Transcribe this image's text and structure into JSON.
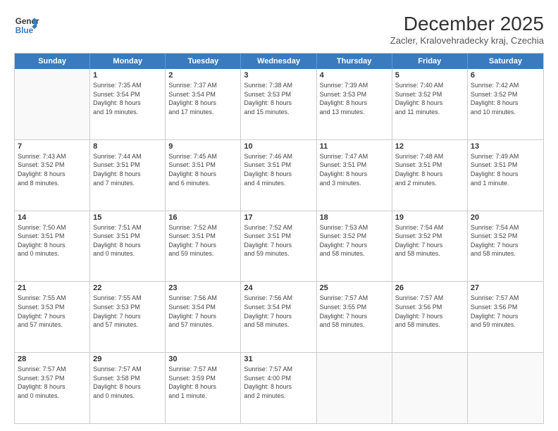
{
  "header": {
    "logo_line1": "General",
    "logo_line2": "Blue",
    "month_title": "December 2025",
    "subtitle": "Zacler, Kralovehradecky kraj, Czechia"
  },
  "weekdays": [
    "Sunday",
    "Monday",
    "Tuesday",
    "Wednesday",
    "Thursday",
    "Friday",
    "Saturday"
  ],
  "rows": [
    [
      {
        "num": "",
        "info": ""
      },
      {
        "num": "1",
        "info": "Sunrise: 7:35 AM\nSunset: 3:54 PM\nDaylight: 8 hours\nand 19 minutes."
      },
      {
        "num": "2",
        "info": "Sunrise: 7:37 AM\nSunset: 3:54 PM\nDaylight: 8 hours\nand 17 minutes."
      },
      {
        "num": "3",
        "info": "Sunrise: 7:38 AM\nSunset: 3:53 PM\nDaylight: 8 hours\nand 15 minutes."
      },
      {
        "num": "4",
        "info": "Sunrise: 7:39 AM\nSunset: 3:53 PM\nDaylight: 8 hours\nand 13 minutes."
      },
      {
        "num": "5",
        "info": "Sunrise: 7:40 AM\nSunset: 3:52 PM\nDaylight: 8 hours\nand 11 minutes."
      },
      {
        "num": "6",
        "info": "Sunrise: 7:42 AM\nSunset: 3:52 PM\nDaylight: 8 hours\nand 10 minutes."
      }
    ],
    [
      {
        "num": "7",
        "info": "Sunrise: 7:43 AM\nSunset: 3:52 PM\nDaylight: 8 hours\nand 8 minutes."
      },
      {
        "num": "8",
        "info": "Sunrise: 7:44 AM\nSunset: 3:51 PM\nDaylight: 8 hours\nand 7 minutes."
      },
      {
        "num": "9",
        "info": "Sunrise: 7:45 AM\nSunset: 3:51 PM\nDaylight: 8 hours\nand 6 minutes."
      },
      {
        "num": "10",
        "info": "Sunrise: 7:46 AM\nSunset: 3:51 PM\nDaylight: 8 hours\nand 4 minutes."
      },
      {
        "num": "11",
        "info": "Sunrise: 7:47 AM\nSunset: 3:51 PM\nDaylight: 8 hours\nand 3 minutes."
      },
      {
        "num": "12",
        "info": "Sunrise: 7:48 AM\nSunset: 3:51 PM\nDaylight: 8 hours\nand 2 minutes."
      },
      {
        "num": "13",
        "info": "Sunrise: 7:49 AM\nSunset: 3:51 PM\nDaylight: 8 hours\nand 1 minute."
      }
    ],
    [
      {
        "num": "14",
        "info": "Sunrise: 7:50 AM\nSunset: 3:51 PM\nDaylight: 8 hours\nand 0 minutes."
      },
      {
        "num": "15",
        "info": "Sunrise: 7:51 AM\nSunset: 3:51 PM\nDaylight: 8 hours\nand 0 minutes."
      },
      {
        "num": "16",
        "info": "Sunrise: 7:52 AM\nSunset: 3:51 PM\nDaylight: 7 hours\nand 59 minutes."
      },
      {
        "num": "17",
        "info": "Sunrise: 7:52 AM\nSunset: 3:51 PM\nDaylight: 7 hours\nand 59 minutes."
      },
      {
        "num": "18",
        "info": "Sunrise: 7:53 AM\nSunset: 3:52 PM\nDaylight: 7 hours\nand 58 minutes."
      },
      {
        "num": "19",
        "info": "Sunrise: 7:54 AM\nSunset: 3:52 PM\nDaylight: 7 hours\nand 58 minutes."
      },
      {
        "num": "20",
        "info": "Sunrise: 7:54 AM\nSunset: 3:52 PM\nDaylight: 7 hours\nand 58 minutes."
      }
    ],
    [
      {
        "num": "21",
        "info": "Sunrise: 7:55 AM\nSunset: 3:53 PM\nDaylight: 7 hours\nand 57 minutes."
      },
      {
        "num": "22",
        "info": "Sunrise: 7:55 AM\nSunset: 3:53 PM\nDaylight: 7 hours\nand 57 minutes."
      },
      {
        "num": "23",
        "info": "Sunrise: 7:56 AM\nSunset: 3:54 PM\nDaylight: 7 hours\nand 57 minutes."
      },
      {
        "num": "24",
        "info": "Sunrise: 7:56 AM\nSunset: 3:54 PM\nDaylight: 7 hours\nand 58 minutes."
      },
      {
        "num": "25",
        "info": "Sunrise: 7:57 AM\nSunset: 3:55 PM\nDaylight: 7 hours\nand 58 minutes."
      },
      {
        "num": "26",
        "info": "Sunrise: 7:57 AM\nSunset: 3:56 PM\nDaylight: 7 hours\nand 58 minutes."
      },
      {
        "num": "27",
        "info": "Sunrise: 7:57 AM\nSunset: 3:56 PM\nDaylight: 7 hours\nand 59 minutes."
      }
    ],
    [
      {
        "num": "28",
        "info": "Sunrise: 7:57 AM\nSunset: 3:57 PM\nDaylight: 8 hours\nand 0 minutes."
      },
      {
        "num": "29",
        "info": "Sunrise: 7:57 AM\nSunset: 3:58 PM\nDaylight: 8 hours\nand 0 minutes."
      },
      {
        "num": "30",
        "info": "Sunrise: 7:57 AM\nSunset: 3:59 PM\nDaylight: 8 hours\nand 1 minute."
      },
      {
        "num": "31",
        "info": "Sunrise: 7:57 AM\nSunset: 4:00 PM\nDaylight: 8 hours\nand 2 minutes."
      },
      {
        "num": "",
        "info": ""
      },
      {
        "num": "",
        "info": ""
      },
      {
        "num": "",
        "info": ""
      }
    ]
  ]
}
